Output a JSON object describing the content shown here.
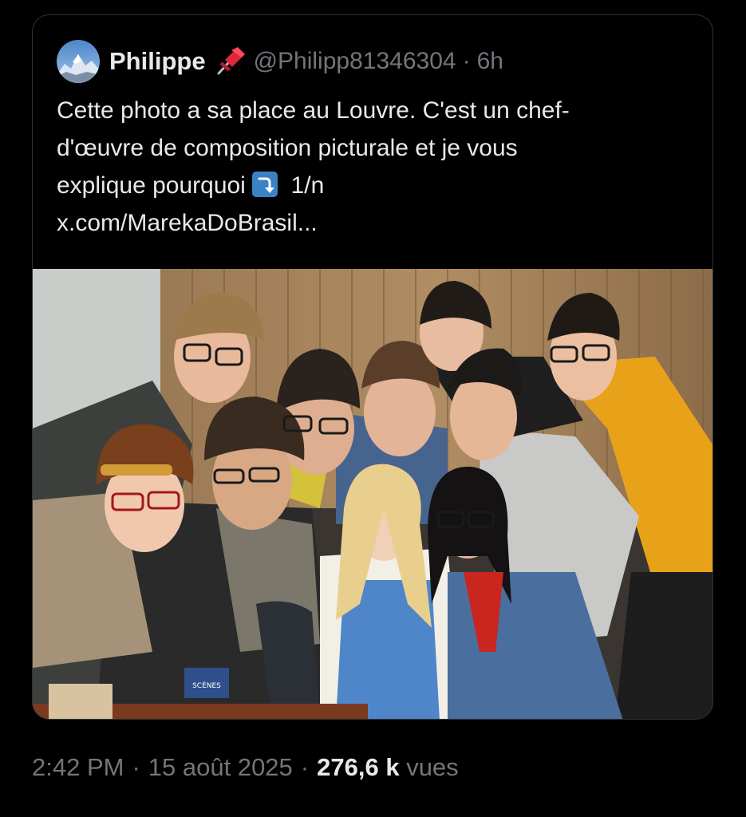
{
  "quoted_post": {
    "author_name": "Philippe",
    "author_badge_icon": "pushpin-icon",
    "handle": "@Philipp81346304",
    "separator": "·",
    "time": "6h",
    "text_lines": [
      "Cette photo a sa place au Louvre. C'est un chef-",
      "d'œuvre de composition picturale et je vous"
    ],
    "text_line3_before": "explique pourquoi",
    "text_line3_emoji": "right-arrow-curving-down-icon",
    "text_line3_after": "1/n",
    "link": "x.com/MarekaDoBrasil...",
    "photo_badge_text": "SCÈNES"
  },
  "post_meta": {
    "time": "2:42 PM",
    "separator": "·",
    "date": "15 août 2025",
    "views_count": "276,6 k",
    "views_label": "vues"
  },
  "colors": {
    "background": "#000000",
    "text_primary": "#e7e9ea",
    "text_secondary": "#71767b",
    "border": "#2f3336",
    "emoji_blue": "#3b82c4"
  }
}
